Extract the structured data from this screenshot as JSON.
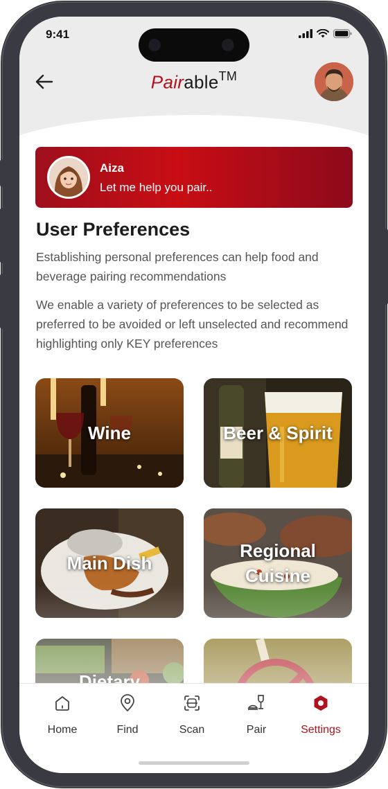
{
  "status_bar": {
    "time": "9:41"
  },
  "header": {
    "brand_accent": "Pair",
    "brand_rest": "able",
    "brand_mark": "TM"
  },
  "assistant": {
    "name": "Aiza",
    "message": "Let me help you pair.."
  },
  "main": {
    "title": "User Preferences",
    "paragraph_1": "Establishing personal preferences can help food and beverage pairing recommendations",
    "paragraph_2": "We enable a variety of preferences to be selected as preferred to be avoided or left unselected and recommend highlighting only KEY preferences",
    "categories": [
      {
        "label": "Wine",
        "icon": "wine-glass-image"
      },
      {
        "label": "Beer & Spirit",
        "icon": "beer-glass-image"
      },
      {
        "label": "Main Dish",
        "icon": "plated-meal-image"
      },
      {
        "label": "Regional Cuisine",
        "icon": "rice-bowl-image"
      },
      {
        "label": "Dietary",
        "icon": "vegetables-image"
      },
      {
        "label": "",
        "icon": "restriction-sign-image"
      }
    ]
  },
  "tabbar": {
    "items": [
      {
        "label": "Home",
        "icon": "home-icon"
      },
      {
        "label": "Find",
        "icon": "location-pin-icon"
      },
      {
        "label": "Scan",
        "icon": "scan-icon"
      },
      {
        "label": "Pair",
        "icon": "pair-glass-plate-icon"
      },
      {
        "label": "Settings",
        "icon": "settings-gear-icon"
      }
    ],
    "active_index": 4
  },
  "colors": {
    "accent": "#b0121d",
    "assistant_gradient_start": "#9e0f1c",
    "assistant_gradient_mid": "#c80d14",
    "header_bg": "#ececec",
    "text_primary": "#1c1c1c",
    "text_secondary": "#555555"
  }
}
